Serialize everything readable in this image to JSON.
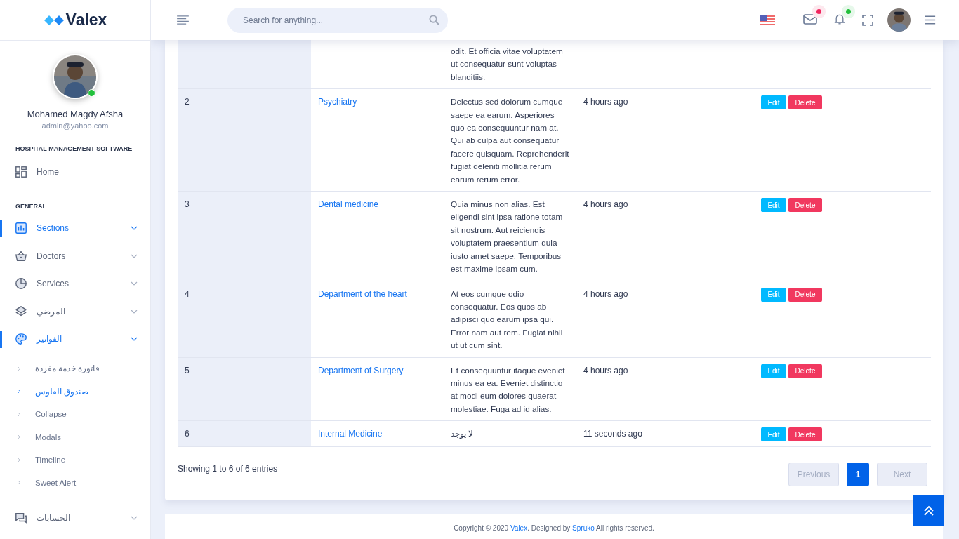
{
  "sidebar": {
    "logo": "Valex",
    "user": {
      "name": "Mohamed Magdy Afsha",
      "email": "admin@yahoo.com",
      "online": true
    },
    "heading": "HOSPITAL MANAGEMENT SOFTWARE",
    "home": {
      "label": "Home",
      "active": false
    },
    "section_title": "GENERAL",
    "items": [
      {
        "label": "Sections",
        "active": true
      },
      {
        "label": "Doctors",
        "active": false
      },
      {
        "label": "Services",
        "active": false
      },
      {
        "label": "المرضي",
        "active": false
      },
      {
        "label": "الفواتير",
        "active": true,
        "children": [
          {
            "label": "فاتورة خدمة مفردة",
            "selected": false
          },
          {
            "label": "صندوق الفلوس",
            "selected": true
          },
          {
            "label": "Collapse",
            "selected": false
          },
          {
            "label": "Modals",
            "selected": false
          },
          {
            "label": "Timeline",
            "selected": false
          },
          {
            "label": "Sweet Alert",
            "selected": false
          }
        ]
      },
      {
        "label": "الحسابات",
        "active": false
      }
    ]
  },
  "header": {
    "search": {
      "placeholder": "Search for anything..."
    },
    "mail_unread": true,
    "notifications_unread": true
  },
  "table": {
    "rows": [
      {
        "description": "odit. Et officia vitae voluptatem ut consequatur sunt voluptas blanditiis."
      },
      {
        "number": "2",
        "name": "Psychiatry",
        "description": "Delectus sed dolorum cumque saepe ea earum. Asperiores quo ea consequuntur nam at. Qui ab culpa aut consequatur facere quisquam. Reprehenderit fugiat deleniti mollitia rerum earum rerum error.",
        "time": "4 hours ago",
        "edit": "Edit",
        "delete": "Delete"
      },
      {
        "number": "3",
        "name": "Dental medicine",
        "description": "Quia minus non alias. Est eligendi sint ipsa ratione totam sit nostrum. Aut reiciendis voluptatem praesentium quia iusto amet saepe. Temporibus est maxime ipsam cum.",
        "time": "4 hours ago",
        "edit": "Edit",
        "delete": "Delete"
      },
      {
        "number": "4",
        "name": "Department of the heart",
        "description": "At eos cumque odio consequatur. Eos quos ab adipisci quo earum ipsa qui. Error nam aut rem. Fugiat nihil ut ut cum sint.",
        "time": "4 hours ago",
        "edit": "Edit",
        "delete": "Delete"
      },
      {
        "number": "5",
        "name": "Department of Surgery",
        "description": "Et consequuntur itaque eveniet minus ea ea. Eveniet distinctio at modi eum dolores quaerat molestiae. Fuga ad id alias.",
        "time": "4 hours ago",
        "edit": "Edit",
        "delete": "Delete"
      },
      {
        "number": "6",
        "name": "Internal Medicine",
        "description": "لا يوجد",
        "time": "11 seconds ago",
        "edit": "Edit",
        "delete": "Delete"
      }
    ],
    "info": "Showing 1 to 6 of 6 entries",
    "pagination": [
      {
        "label": "Previous",
        "kind": "nav",
        "disabled": true,
        "selected": false
      },
      {
        "label": "1",
        "kind": "page",
        "disabled": false,
        "selected": true
      },
      {
        "label": "Next",
        "kind": "nav",
        "disabled": true,
        "selected": false
      }
    ]
  },
  "footer": {
    "before": "Copyright © 2020 ",
    "brand": "Valex",
    "middle": ". Designed by ",
    "designer": "Spruko",
    "after": " All rights reserved."
  }
}
